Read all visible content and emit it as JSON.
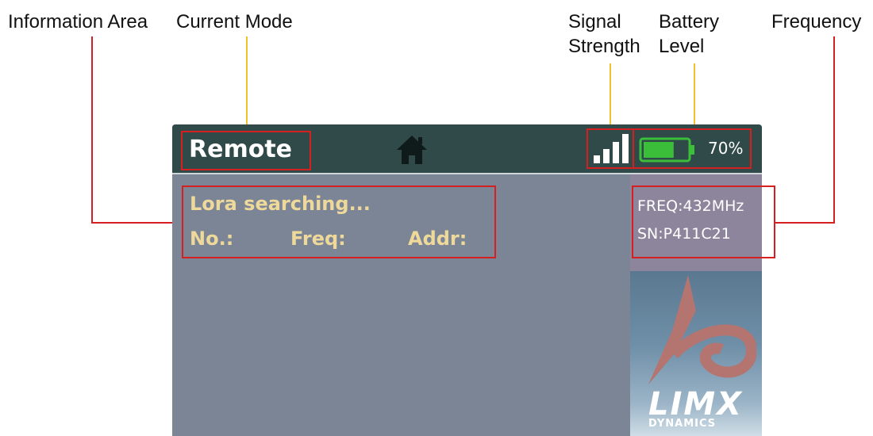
{
  "callouts": {
    "information_area": "Information Area",
    "current_mode": "Current Mode",
    "signal_strength_line1": "Signal",
    "signal_strength_line2": "Strength",
    "battery_level_line1": "Battery",
    "battery_level_line2": "Level",
    "frequency": "Frequency"
  },
  "status_bar": {
    "mode": "Remote",
    "home_icon": "home-icon",
    "signal_icon": "signal-bars-icon",
    "signal_bars": 4,
    "battery_icon": "battery-icon",
    "battery_level": 0.7,
    "battery_percent": "70%"
  },
  "info_area": {
    "status": "Lora searching...",
    "no_label": "No.:",
    "freq_label": "Freq:",
    "addr_label": "Addr:"
  },
  "side_panel": {
    "freq": "FREQ:432MHz",
    "sn": "SN:P411C21",
    "logo_text": "LIMX",
    "logo_sub": "DYNAMICS"
  },
  "colors": {
    "status_bar_bg": "#2f4a48",
    "screen_bg": "#7c8596",
    "info_text": "#eed99b",
    "battery_fill": "#3bbf3b",
    "callout_red": "#d62020",
    "callout_yellow": "#f2c12e"
  }
}
